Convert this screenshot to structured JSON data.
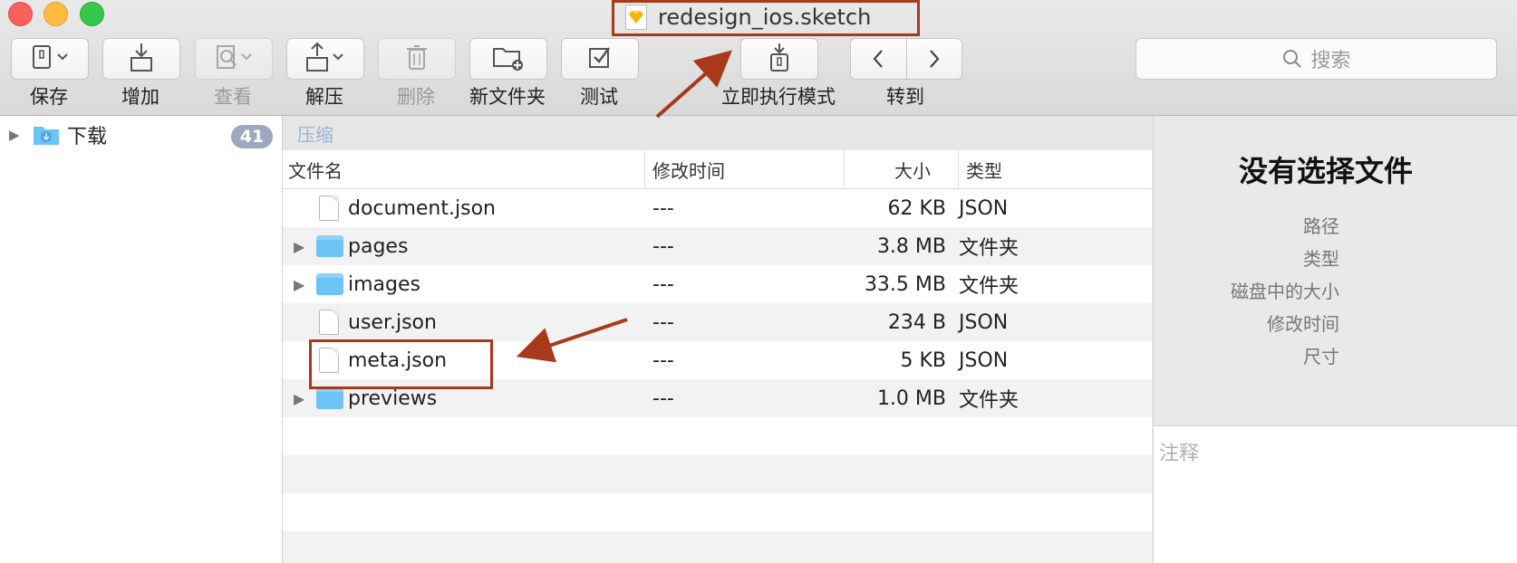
{
  "window": {
    "title": "redesign_ios.sketch"
  },
  "toolbar": {
    "buttons": [
      {
        "label": "保存",
        "icon": "archive-save-icon",
        "enabled": true
      },
      {
        "label": "增加",
        "icon": "add-tray-icon",
        "enabled": true
      },
      {
        "label": "查看",
        "icon": "quicklook-icon",
        "enabled": false
      },
      {
        "label": "解压",
        "icon": "extract-icon",
        "enabled": true
      },
      {
        "label": "删除",
        "icon": "trash-icon",
        "enabled": false
      },
      {
        "label": "新文件夹",
        "icon": "new-folder-icon",
        "enabled": true
      },
      {
        "label": "测试",
        "icon": "checkbox-icon",
        "enabled": true
      },
      {
        "label": "立即执行模式",
        "icon": "instant-archive-icon",
        "enabled": true
      },
      {
        "label": "转到",
        "icon": "back-forward-icon",
        "enabled": true
      }
    ],
    "search_placeholder": "搜索"
  },
  "sidebar": {
    "items": [
      {
        "label": "下载",
        "icon": "downloads-folder-icon",
        "count": "41"
      }
    ]
  },
  "pathbar": {
    "label": "压缩"
  },
  "file_list": {
    "columns": [
      "文件名",
      "修改时间",
      "大小",
      "类型"
    ],
    "rows": [
      {
        "name": "document.json",
        "modified": "---",
        "size": "62 KB",
        "kind": "JSON",
        "is_folder": false
      },
      {
        "name": "pages",
        "modified": "---",
        "size": "3.8 MB",
        "kind": "文件夹",
        "is_folder": true
      },
      {
        "name": "images",
        "modified": "---",
        "size": "33.5 MB",
        "kind": "文件夹",
        "is_folder": true
      },
      {
        "name": "user.json",
        "modified": "---",
        "size": "234 B",
        "kind": "JSON",
        "is_folder": false
      },
      {
        "name": "meta.json",
        "modified": "---",
        "size": "5 KB",
        "kind": "JSON",
        "is_folder": false
      },
      {
        "name": "previews",
        "modified": "---",
        "size": "1.0 MB",
        "kind": "文件夹",
        "is_folder": true
      }
    ]
  },
  "info_panel": {
    "title": "没有选择文件",
    "labels": [
      "路径",
      "类型",
      "磁盘中的大小",
      "修改时间",
      "尺寸"
    ],
    "notes_placeholder": "注释"
  },
  "annotations": {
    "color": "#a8391a"
  }
}
